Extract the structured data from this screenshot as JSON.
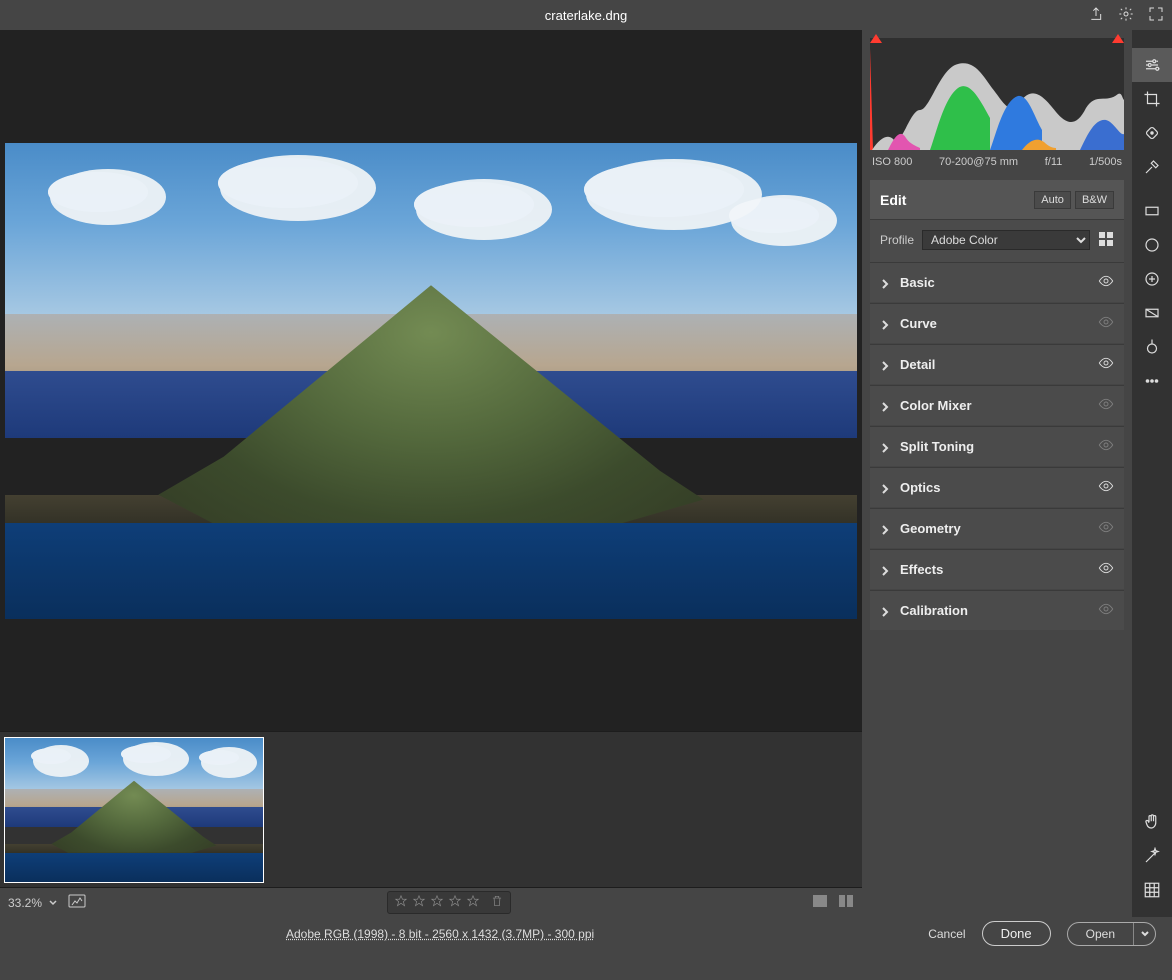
{
  "titlebar": {
    "filename": "craterlake.dng"
  },
  "histogram": {
    "iso": "ISO 800",
    "lens": "70-200@75 mm",
    "aperture": "f/11",
    "shutter": "1/500s"
  },
  "edit": {
    "title": "Edit",
    "auto_label": "Auto",
    "bw_label": "B&W",
    "profile_label": "Profile",
    "profile_value": "Adobe Color"
  },
  "panels": [
    {
      "name": "Basic",
      "enabled": true
    },
    {
      "name": "Curve",
      "enabled": false
    },
    {
      "name": "Detail",
      "enabled": true
    },
    {
      "name": "Color Mixer",
      "enabled": false
    },
    {
      "name": "Split Toning",
      "enabled": false
    },
    {
      "name": "Optics",
      "enabled": true
    },
    {
      "name": "Geometry",
      "enabled": false
    },
    {
      "name": "Effects",
      "enabled": true
    },
    {
      "name": "Calibration",
      "enabled": false
    }
  ],
  "statusbar": {
    "zoom": "33.2%"
  },
  "footer": {
    "summary": "Adobe RGB (1998) - 8 bit - 2560 x 1432 (3.7MP) - 300 ppi",
    "cancel": "Cancel",
    "done": "Done",
    "open": "Open"
  }
}
